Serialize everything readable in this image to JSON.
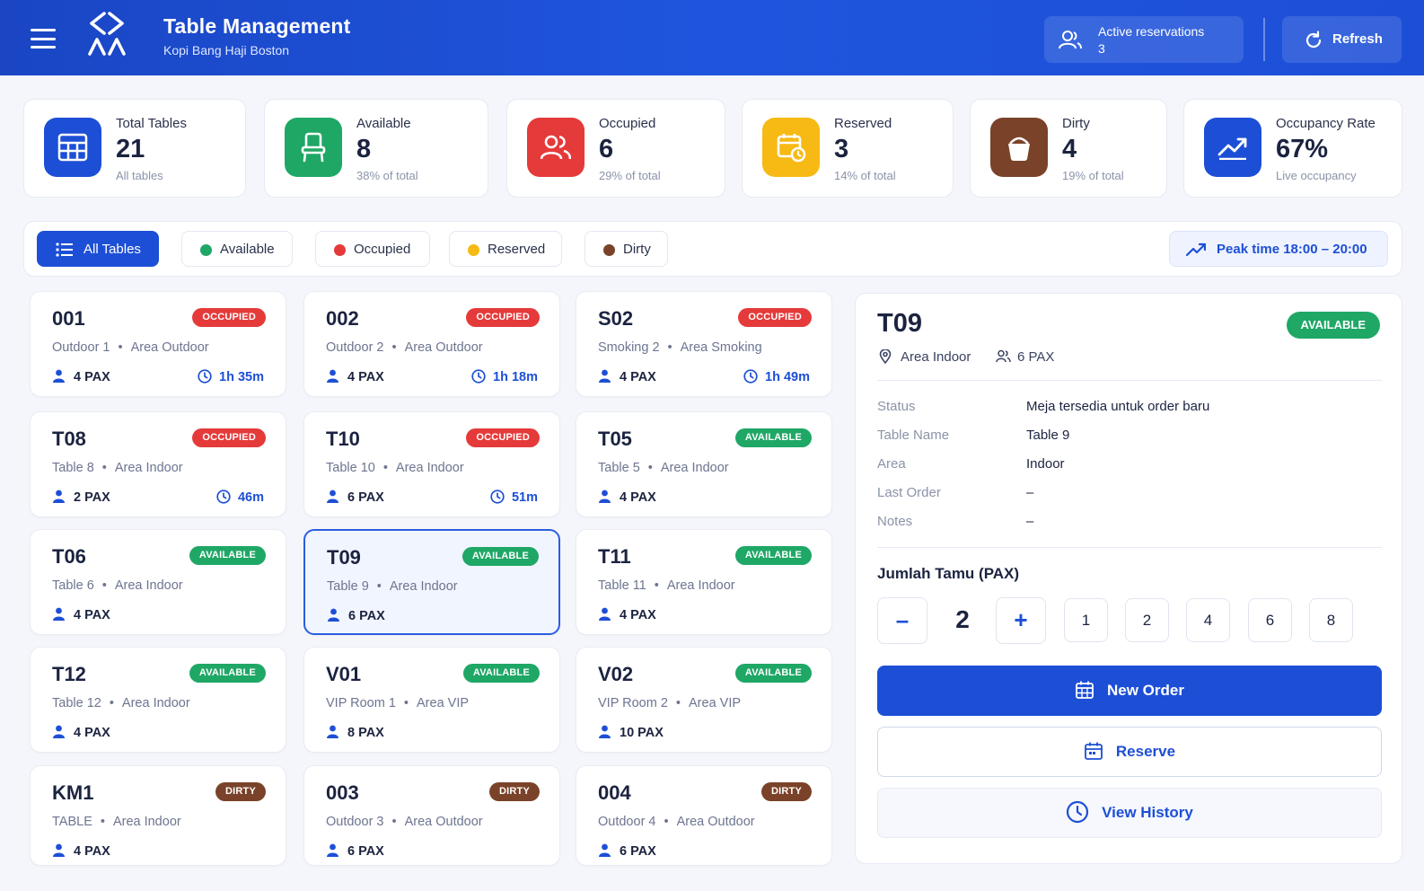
{
  "header": {
    "title": "Table Management",
    "subtitle": "Kopi Bang Haji Boston",
    "active_reservations_label": "Active reservations",
    "active_reservations_value": "3",
    "refresh_label": "Refresh"
  },
  "stats": [
    {
      "label": "Total Tables",
      "value": "21",
      "sub": "All tables",
      "color": "#1d4fd6",
      "icon": "grid-icon"
    },
    {
      "label": "Available",
      "value": "8",
      "sub": "38% of total",
      "color": "#1fa766",
      "icon": "chair-icon"
    },
    {
      "label": "Occupied",
      "value": "6",
      "sub": "29% of total",
      "color": "#e53a3a",
      "icon": "users-icon"
    },
    {
      "label": "Reserved",
      "value": "3",
      "sub": "14% of total",
      "color": "#f7b914",
      "icon": "calendar-clock-icon"
    },
    {
      "label": "Dirty",
      "value": "4",
      "sub": "19% of total",
      "color": "#7a4329",
      "icon": "bucket-icon"
    },
    {
      "label": "Occupancy Rate",
      "value": "67%",
      "sub": "Live occupancy",
      "color": "#1d4fd6",
      "icon": "trend-icon"
    }
  ],
  "filters": {
    "all": "All Tables",
    "available": "Available",
    "occupied": "Occupied",
    "reserved": "Reserved",
    "dirty": "Dirty",
    "peak": "Peak time 18:00 – 20:00",
    "colors": {
      "available": "#1fa766",
      "occupied": "#e53a3a",
      "reserved": "#f7b914",
      "dirty": "#7a4329"
    }
  },
  "tables": [
    {
      "id": "001",
      "name": "Outdoor 1",
      "area": "Area Outdoor",
      "pax": "4 PAX",
      "status": "OCCUPIED",
      "duration": "1h 35m"
    },
    {
      "id": "002",
      "name": "Outdoor 2",
      "area": "Area Outdoor",
      "pax": "4 PAX",
      "status": "OCCUPIED",
      "duration": "1h 18m"
    },
    {
      "id": "S02",
      "name": "Smoking 2",
      "area": "Area Smoking",
      "pax": "4 PAX",
      "status": "OCCUPIED",
      "duration": "1h 49m"
    },
    {
      "id": "T08",
      "name": "Table 8",
      "area": "Area Indoor",
      "pax": "2 PAX",
      "status": "OCCUPIED",
      "duration": "46m"
    },
    {
      "id": "T10",
      "name": "Table 10",
      "area": "Area Indoor",
      "pax": "6 PAX",
      "status": "OCCUPIED",
      "duration": "51m"
    },
    {
      "id": "T05",
      "name": "Table 5",
      "area": "Area Indoor",
      "pax": "4 PAX",
      "status": "AVAILABLE",
      "duration": ""
    },
    {
      "id": "T06",
      "name": "Table 6",
      "area": "Area Indoor",
      "pax": "4 PAX",
      "status": "AVAILABLE",
      "duration": ""
    },
    {
      "id": "T09",
      "name": "Table 9",
      "area": "Area Indoor",
      "pax": "6 PAX",
      "status": "AVAILABLE",
      "duration": "",
      "selected": true
    },
    {
      "id": "T11",
      "name": "Table 11",
      "area": "Area Indoor",
      "pax": "4 PAX",
      "status": "AVAILABLE",
      "duration": ""
    },
    {
      "id": "T12",
      "name": "Table 12",
      "area": "Area Indoor",
      "pax": "4 PAX",
      "status": "AVAILABLE",
      "duration": ""
    },
    {
      "id": "V01",
      "name": "VIP Room 1",
      "area": "Area VIP",
      "pax": "8 PAX",
      "status": "AVAILABLE",
      "duration": ""
    },
    {
      "id": "V02",
      "name": "VIP Room 2",
      "area": "Area VIP",
      "pax": "10 PAX",
      "status": "AVAILABLE",
      "duration": ""
    },
    {
      "id": "KM1",
      "name": "TABLE",
      "area": "Area Indoor",
      "pax": "4 PAX",
      "status": "DIRTY",
      "duration": ""
    },
    {
      "id": "003",
      "name": "Outdoor 3",
      "area": "Area Outdoor",
      "pax": "6 PAX",
      "status": "DIRTY",
      "duration": ""
    },
    {
      "id": "004",
      "name": "Outdoor 4",
      "area": "Area Outdoor",
      "pax": "6 PAX",
      "status": "DIRTY",
      "duration": ""
    }
  ],
  "detail": {
    "title": "T09",
    "status_badge": "AVAILABLE",
    "area": "Area Indoor",
    "pax": "6 PAX",
    "rows": [
      {
        "k": "Status",
        "v": "Meja tersedia untuk order baru"
      },
      {
        "k": "Table Name",
        "v": "Table 9"
      },
      {
        "k": "Area",
        "v": "Indoor"
      },
      {
        "k": "Last Order",
        "v": "–"
      },
      {
        "k": "Notes",
        "v": "–"
      }
    ],
    "guests_label": "Jumlah Tamu (PAX)",
    "minus": "–",
    "plus": "+",
    "guests_value": "2",
    "quick_values": [
      "1",
      "2",
      "4",
      "6",
      "8"
    ],
    "new_order": "New Order",
    "reserve": "Reserve",
    "view_history": "View History"
  }
}
